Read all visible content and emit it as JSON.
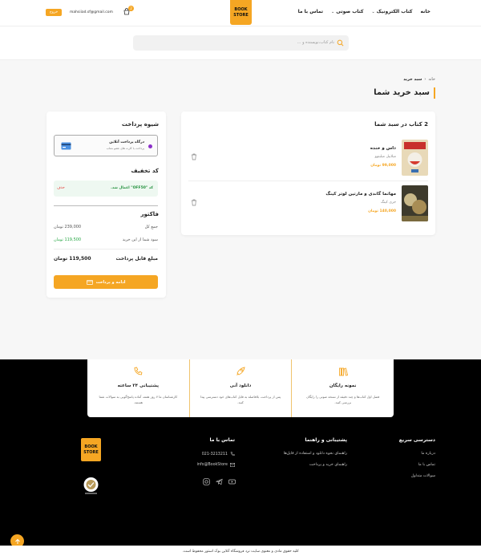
{
  "header": {
    "nav": [
      "خانه",
      "کتاب الکترونیک",
      "کتاب صوتی",
      "تماس با ما"
    ],
    "logo_line1": "BOOK",
    "logo_line2": "STORE",
    "cart_count": "2",
    "user_email": "mahsiiad.sf@gmail.com",
    "logout_label": "خروج"
  },
  "search": {
    "placeholder": "نام کتاب،نویسنده و ..."
  },
  "breadcrumb": {
    "home": "خانه",
    "current": "سبد خرید"
  },
  "page_title": "سبد خرید شما",
  "cart": {
    "heading": "2 کتاب در سبد شما",
    "items": [
      {
        "title": "داس و خنده",
        "author": "میلاییل میلیتوو",
        "price": "99,000 تومان"
      },
      {
        "title": "مهاتما گاندی و مارتین لوتر کینگ",
        "author": "جری کینگ",
        "price": "140,000 تومان"
      }
    ]
  },
  "payment": {
    "title": "شیوه پرداخت",
    "gateway_title": "درگاه پرداخت آنلاین",
    "gateway_sub": "پرداخت با کارت های عضو شتاب",
    "discount_title": "کد تخفیف",
    "discount_applied": "کد \"OFF50\" اعمال شد.",
    "discount_remove": "حذف",
    "invoice_title": "فاکتور",
    "subtotal_label": "جمع کل",
    "subtotal_value": "239,000 تومان",
    "saving_label": "سود شما از این خرید",
    "saving_value": "119,500 تومان",
    "payable_label": "مبلغ قابل پرداخت",
    "payable_value": "119,500 تومان",
    "checkout_label": "ادامه و پرداخت"
  },
  "features": [
    {
      "title": "نمونه رایگان",
      "desc": "فصل اول کتاب‌ها و چند دقیقه از نسخه صوتی را رایگان بررسی کنید."
    },
    {
      "title": "دانلود آنی",
      "desc": "پس از پرداخت، بلافاصله به فایل کتاب‌های خود دسترسی پیدا کنید."
    },
    {
      "title": "پشتیبانی ۲۴ ساعته",
      "desc": "کارشناسان ما ۷ روز هفته، آماده پاسخ‌گویی به سوالات شما هستند."
    }
  ],
  "footer": {
    "quick_title": "دسترسی سریع",
    "quick_links": [
      "درباره ما",
      "تماس با ما",
      "سوالات متداول"
    ],
    "support_title": "پشتیبانی و راهنما",
    "support_links": [
      "راهنمای نحوه دانلود و استفاده از فایل‌ها",
      "راهنمای خرید و پرداخت"
    ],
    "contact_title": "تماس با ما",
    "phone": "021-3213211",
    "email": "info@BookStore",
    "logo_line1": "BOOK",
    "logo_line2": "STORE",
    "copyright": "کلیه حقوق مادی و معنوی سایت نزد فروشگاه آنلاین بوک استور محفوظ است."
  },
  "colors": {
    "accent": "#f5a623",
    "success": "#27a745",
    "danger": "#e53935"
  }
}
